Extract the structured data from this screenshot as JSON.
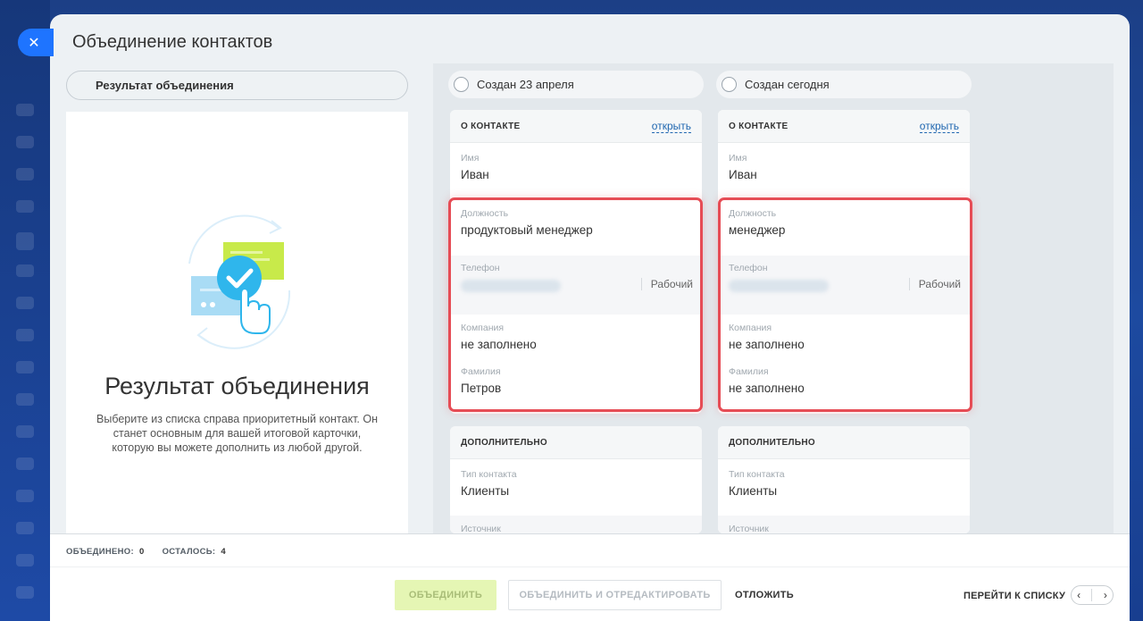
{
  "window": {
    "title": "Объединение контактов"
  },
  "close_icon": "close-icon",
  "result": {
    "pill_label": "Результат объединения",
    "heading": "Результат объединения",
    "description": "Выберите из списка справа приоритетный контакт. Он станет основным для вашей итоговой карточки, которую вы можете дополнить из любой другой."
  },
  "columns": [
    {
      "header": "Создан 23 апреля",
      "about_title": "О КОНТАКТЕ",
      "open_link": "открыть",
      "fields": {
        "name": {
          "label": "Имя",
          "value": "Иван"
        },
        "position": {
          "label": "Должность",
          "value": "продуктовый менеджер"
        },
        "phone": {
          "label": "Телефон",
          "type": "Рабочий"
        },
        "company": {
          "label": "Компания",
          "value": "не заполнено"
        },
        "surname": {
          "label": "Фамилия",
          "value": "Петров"
        }
      },
      "extra_title": "ДОПОЛНИТЕЛЬНО",
      "extra": {
        "contact_type": {
          "label": "Тип контакта",
          "value": "Клиенты"
        },
        "source": {
          "label": "Источник"
        }
      }
    },
    {
      "header": "Создан сегодня",
      "about_title": "О КОНТАКТЕ",
      "open_link": "открыть",
      "fields": {
        "name": {
          "label": "Имя",
          "value": "Иван"
        },
        "position": {
          "label": "Должность",
          "value": "менеджер"
        },
        "phone": {
          "label": "Телефон",
          "type": "Рабочий"
        },
        "company": {
          "label": "Компания",
          "value": "не заполнено"
        },
        "surname": {
          "label": "Фамилия",
          "value": "не заполнено"
        }
      },
      "extra_title": "ДОПОЛНИТЕЛЬНО",
      "extra": {
        "contact_type": {
          "label": "Тип контакта",
          "value": "Клиенты"
        },
        "source": {
          "label": "Источник"
        }
      }
    }
  ],
  "footer": {
    "merged_label": "ОБЪЕДИНЕНО:",
    "merged_count": "0",
    "left_label": "ОСТАЛОСЬ:",
    "left_count": "4",
    "merge_button": "ОБЪЕДИНИТЬ",
    "merge_edit_button": "ОБЪЕДИНИТЬ И ОТРЕДАКТИРОВАТЬ",
    "postpone_button": "ОТЛОЖИТЬ",
    "goto_list": "ПЕРЕЙТИ К СПИСКУ",
    "prev_icon": "chevron-left-icon",
    "next_icon": "chevron-right-icon"
  },
  "colors": {
    "accent_blue": "#1e74ff",
    "highlight_red": "#e64c55",
    "merge_button_bg": "#e5f6b4",
    "link": "#2067b0"
  }
}
